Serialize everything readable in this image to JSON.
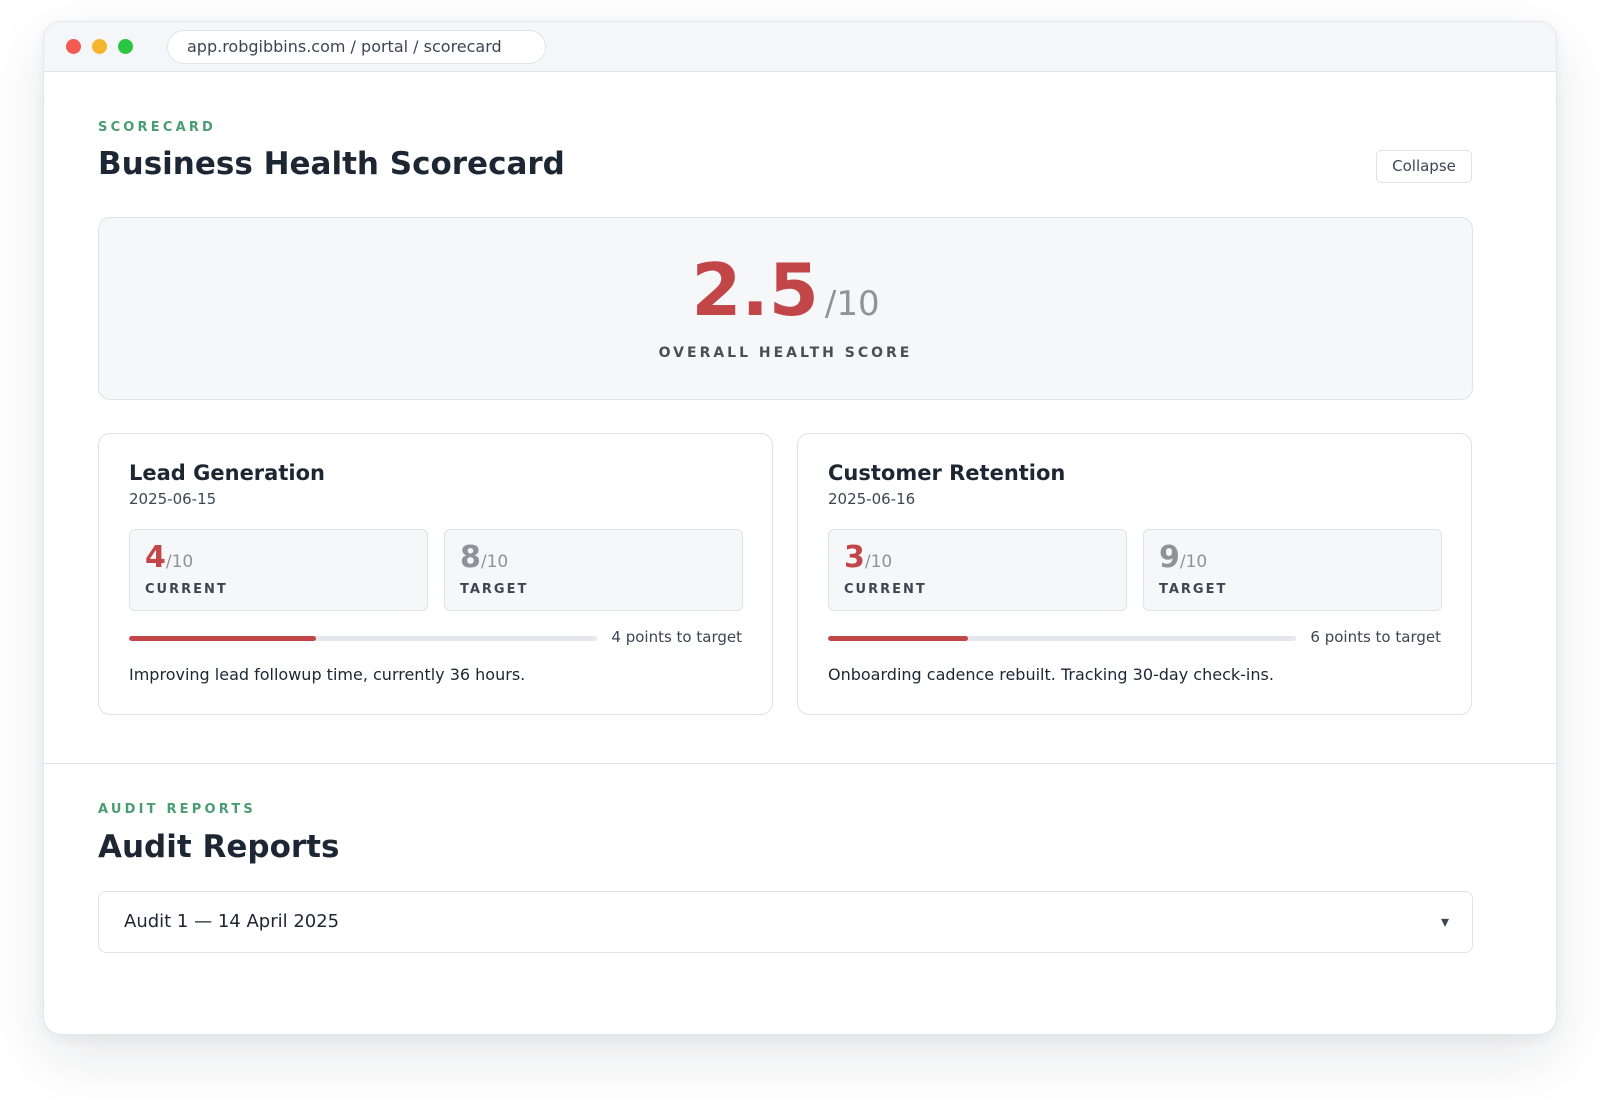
{
  "browser": {
    "url": "app.robgibbins.com / portal / scorecard"
  },
  "scorecard": {
    "eyebrow": "SCORECARD",
    "title": "Business Health Scorecard",
    "collapse_label": "Collapse",
    "overall": {
      "score": "2.5",
      "denominator": "/10",
      "label": "OVERALL HEALTH SCORE"
    },
    "metrics": [
      {
        "title": "Lead Generation",
        "date": "2025-06-15",
        "current": "4",
        "current_den": "/10",
        "current_label": "CURRENT",
        "target": "8",
        "target_den": "/10",
        "target_label": "TARGET",
        "progress_fraction": 0.4,
        "points_text": "4 points to target",
        "note": "Improving lead followup time, currently 36 hours."
      },
      {
        "title": "Customer Retention",
        "date": "2025-06-16",
        "current": "3",
        "current_den": "/10",
        "current_label": "CURRENT",
        "target": "9",
        "target_den": "/10",
        "target_label": "TARGET",
        "progress_fraction": 0.3,
        "points_text": "6 points to target",
        "note": "Onboarding cadence rebuilt. Tracking 30-day check-ins."
      }
    ]
  },
  "audit": {
    "eyebrow": "AUDIT REPORTS",
    "title": "Audit Reports",
    "items": [
      {
        "label": "Audit 1 — 14 April 2025",
        "toggle_icon": "▾"
      }
    ]
  },
  "colors": {
    "accent_green": "#4a9c72",
    "score_red": "#c24548",
    "muted_gray": "#8e9399"
  }
}
